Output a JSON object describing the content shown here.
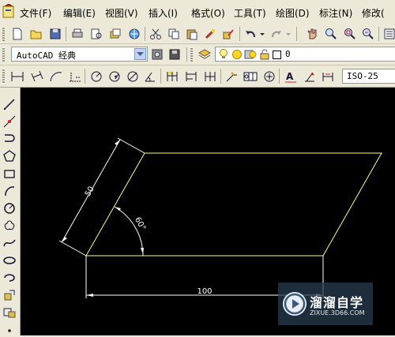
{
  "menubar": {
    "items": [
      "文件(F)",
      "编辑(E)",
      "视图(V)",
      "插入(I)",
      "格式(O)",
      "工具(T)",
      "绘图(D)",
      "标注(N)",
      "修改("
    ]
  },
  "toolbar1": {
    "icons": [
      "new-file-icon",
      "open-file-icon",
      "save-icon",
      "print-icon",
      "print-preview-icon",
      "publish-icon",
      "3d-dwf-icon",
      "cut-icon",
      "copy-icon",
      "paste-icon",
      "match-properties-icon",
      "block-editor-icon",
      "undo-icon",
      "undo-dropdown-icon",
      "redo-icon",
      "redo-dropdown-icon",
      "pan-icon",
      "zoom-realtime-icon",
      "zoom-window-icon",
      "zoom-previous-icon",
      "properties-icon"
    ]
  },
  "toolbar2": {
    "workspace_value": "AutoCAD 经典",
    "layer_value": "0"
  },
  "toolbar3": {
    "dim_style_value": "ISO-25"
  },
  "leftbar": {
    "tools": [
      "line-icon",
      "construction-line-icon",
      "polyline-icon",
      "polygon-icon",
      "rectangle-icon",
      "arc-icon",
      "circle-icon",
      "revision-cloud-icon",
      "spline-icon",
      "ellipse-icon",
      "ellipse-arc-icon",
      "insert-block-icon",
      "make-block-icon",
      "point-icon"
    ]
  },
  "drawing": {
    "colors": {
      "shape": "#ffff66",
      "dimension": "#ffffff",
      "background": "#000000"
    },
    "dimensions": {
      "side_length": "50",
      "angle": "60°",
      "base_length": "100"
    }
  },
  "watermark": {
    "title": "溜溜自学",
    "subtitle": "ZIXUE.3D66.COM"
  }
}
